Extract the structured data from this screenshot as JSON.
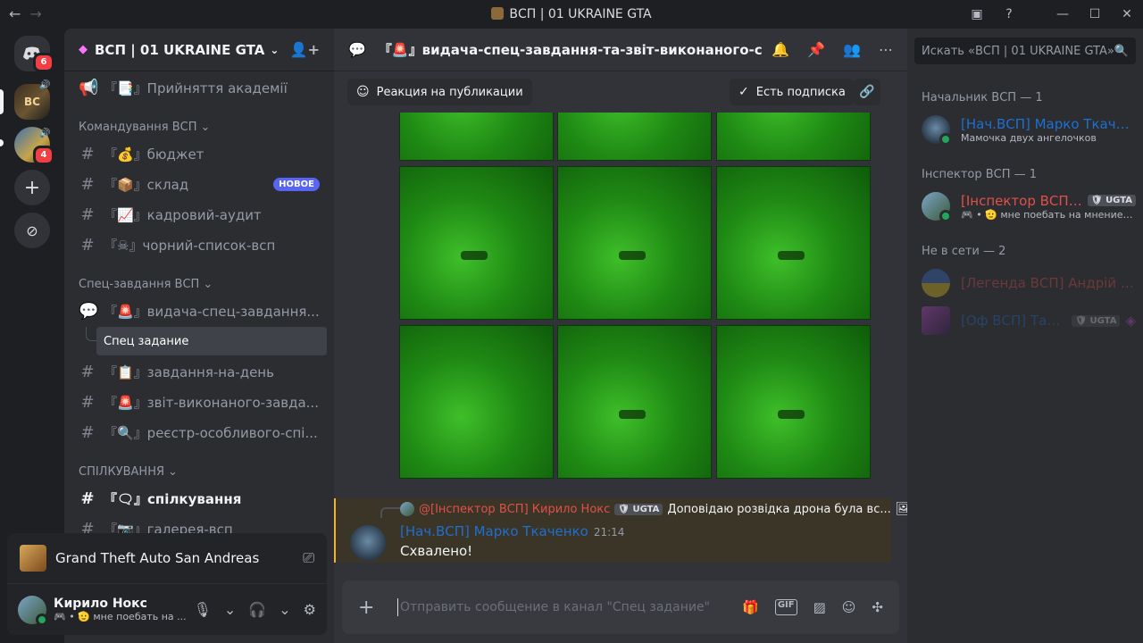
{
  "window": {
    "title": "ВСП | 01 UKRAINE GTA",
    "nav_back": "←",
    "nav_forward": "→",
    "inbox_icon": "inbox",
    "help_icon": "?",
    "minimize": "—",
    "maximize": "☐",
    "close": "✕"
  },
  "rail": {
    "dm_badge": "6",
    "server2_badge": "4",
    "server1_label": "BC"
  },
  "server": {
    "name": "ВСП | 01 UKRAINE GTA"
  },
  "channels": {
    "top": {
      "label": "『📑』Прийняття академії"
    },
    "category1": "Командування ВСП",
    "c1": {
      "label": "『💰』бюджет"
    },
    "c2": {
      "label": "『📦』склад",
      "badge": "НОВОЕ"
    },
    "c3": {
      "label": "『📈』кадровий-аудит"
    },
    "c4": {
      "label": "『☠』чорний-список-всп"
    },
    "category2": "Спец-завдання ВСП",
    "c5": {
      "label": "『🚨』видача-спец-завдання..."
    },
    "thread": {
      "label": "Спец задание"
    },
    "c6": {
      "label": "『📋』завдання-на-день"
    },
    "c7": {
      "label": "『🚨』звіт-виконаного-завда..."
    },
    "c8": {
      "label": "『🔍』реєстр-особливого-спі..."
    },
    "category3": "СПІЛКУВАННЯ",
    "c9": {
      "label": "『🗨』спілкування"
    },
    "c10": {
      "label": "『📷』галерея-всп"
    }
  },
  "activity": {
    "game": "Grand Theft Auto San Andreas"
  },
  "user": {
    "name": "Кирило Нокс",
    "status": "🎮 • 🫡 мне поебать на ..."
  },
  "chat": {
    "channel_title": "『🚨』видача-спец-завдання-та-звіт-виконаного-спец-завдання",
    "reaction_button": "Реакция на публикации",
    "subscription_button": "Есть подписка",
    "reply": {
      "author": "@[Інспектор ВСП] Кирило Нокс",
      "tag": "UGTA",
      "text": "Доповідаю розвідка дрона була вс..."
    },
    "message": {
      "author": "[Нач.ВСП] Марко Ткаченко",
      "time": "21:14",
      "text": "Схвалено!"
    },
    "composer_placeholder": "Отправить сообщение в канал \"Спец задание\""
  },
  "members": {
    "search_placeholder": "Искать «ВСП | 01 UKRAINE GTA»",
    "group1": "Начальник ВСП — 1",
    "m1": {
      "name": "[Нач.ВСП] Марко Ткаченко",
      "status": "Мамочка двух ангелочков"
    },
    "group2": "Інспектор ВСП — 1",
    "m2": {
      "name": "[Інспектор ВСП]...",
      "tag": "UGTA",
      "status": "🎮 • 🫡 мне поебать на мнение л..."
    },
    "group3": "Не в сети — 2",
    "m3": {
      "name": "[Легенда ВСП] Андрій Б..."
    },
    "m4": {
      "name": "[Оф ВСП] Тай...",
      "tag": "UGTA"
    }
  },
  "colors": {
    "accent": "#5865f2",
    "online": "#23a55a",
    "mention_bg": "#3a3527",
    "chief_name": "#1f6fcf",
    "inspector_name": "#e0504a"
  }
}
